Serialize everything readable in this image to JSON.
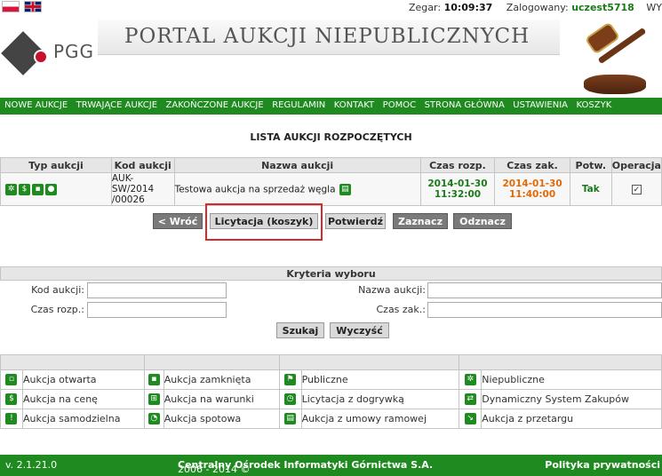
{
  "header": {
    "clock_label": "Zegar:",
    "clock": "10:09:37",
    "user_label": "Zalogowany:",
    "user": "uczest5718",
    "logout": "WYLOGUJ",
    "logo_text": "PGG",
    "portal_title": "PORTAL AUKCJI NIEPUBLICZNYCH"
  },
  "nav": [
    "NOWE AUKCJE",
    "TRWAJĄCE AUKCJE",
    "ZAKOŃCZONE AUKCJE",
    "REGULAMIN",
    "KONTAKT",
    "POMOC",
    "STRONA GŁÓWNA",
    "USTAWIENIA",
    "KOSZYK"
  ],
  "list": {
    "title": "LISTA AUKCJI ROZPOCZĘTYCH",
    "columns": [
      "Typ aukcji",
      "Kod aukcji",
      "Nazwa aukcji",
      "Czas rozp.",
      "Czas zak.",
      "Potw.",
      "Operacja"
    ],
    "rows": [
      {
        "code_line1": "AUK-SW/2014",
        "code_line2": "/00026",
        "name": "Testowa aukcja na sprzedaż węgla",
        "start_date": "2014-01-30",
        "start_time": "11:32:00",
        "end_date": "2014-01-30",
        "end_time": "11:40:00",
        "confirmed": "Tak"
      }
    ]
  },
  "buttons": {
    "back": "< Wróć",
    "bid": "Licytacja (koszyk)",
    "confirm": "Potwierdź",
    "select": "Zaznacz",
    "deselect": "Odznacz"
  },
  "criteria": {
    "title": "Kryteria wyboru",
    "code_label": "Kod aukcji:",
    "name_label": "Nazwa aukcji:",
    "start_label": "Czas rozp.:",
    "end_label": "Czas zak.:",
    "search": "Szukaj",
    "clear": "Wyczyść"
  },
  "legend": [
    [
      "Aukcja otwarta",
      "Aukcja zamknięta",
      "Publiczne",
      "Niepubliczne"
    ],
    [
      "Aukcja na cenę",
      "Aukcja na warunki",
      "Licytacja z dogrywką",
      "Dynamiczny System Zakupów"
    ],
    [
      "Aukcja samodzielna",
      "Aukcja spotowa",
      "Aukcja z umowy ramowej",
      "Aukcja z przetargu"
    ]
  ],
  "footer": {
    "version": "v. 2.1.21.0",
    "copyright_years": "2006 - 2014 ©",
    "company": "Centralny Ośrodek Informatyki Górnictwa S.A.",
    "privacy": "Polityka prywatności"
  },
  "colors": {
    "brand_green": "#1f8a1f",
    "end_date_orange": "#e06a0a",
    "highlight_red": "#d62a2a"
  }
}
